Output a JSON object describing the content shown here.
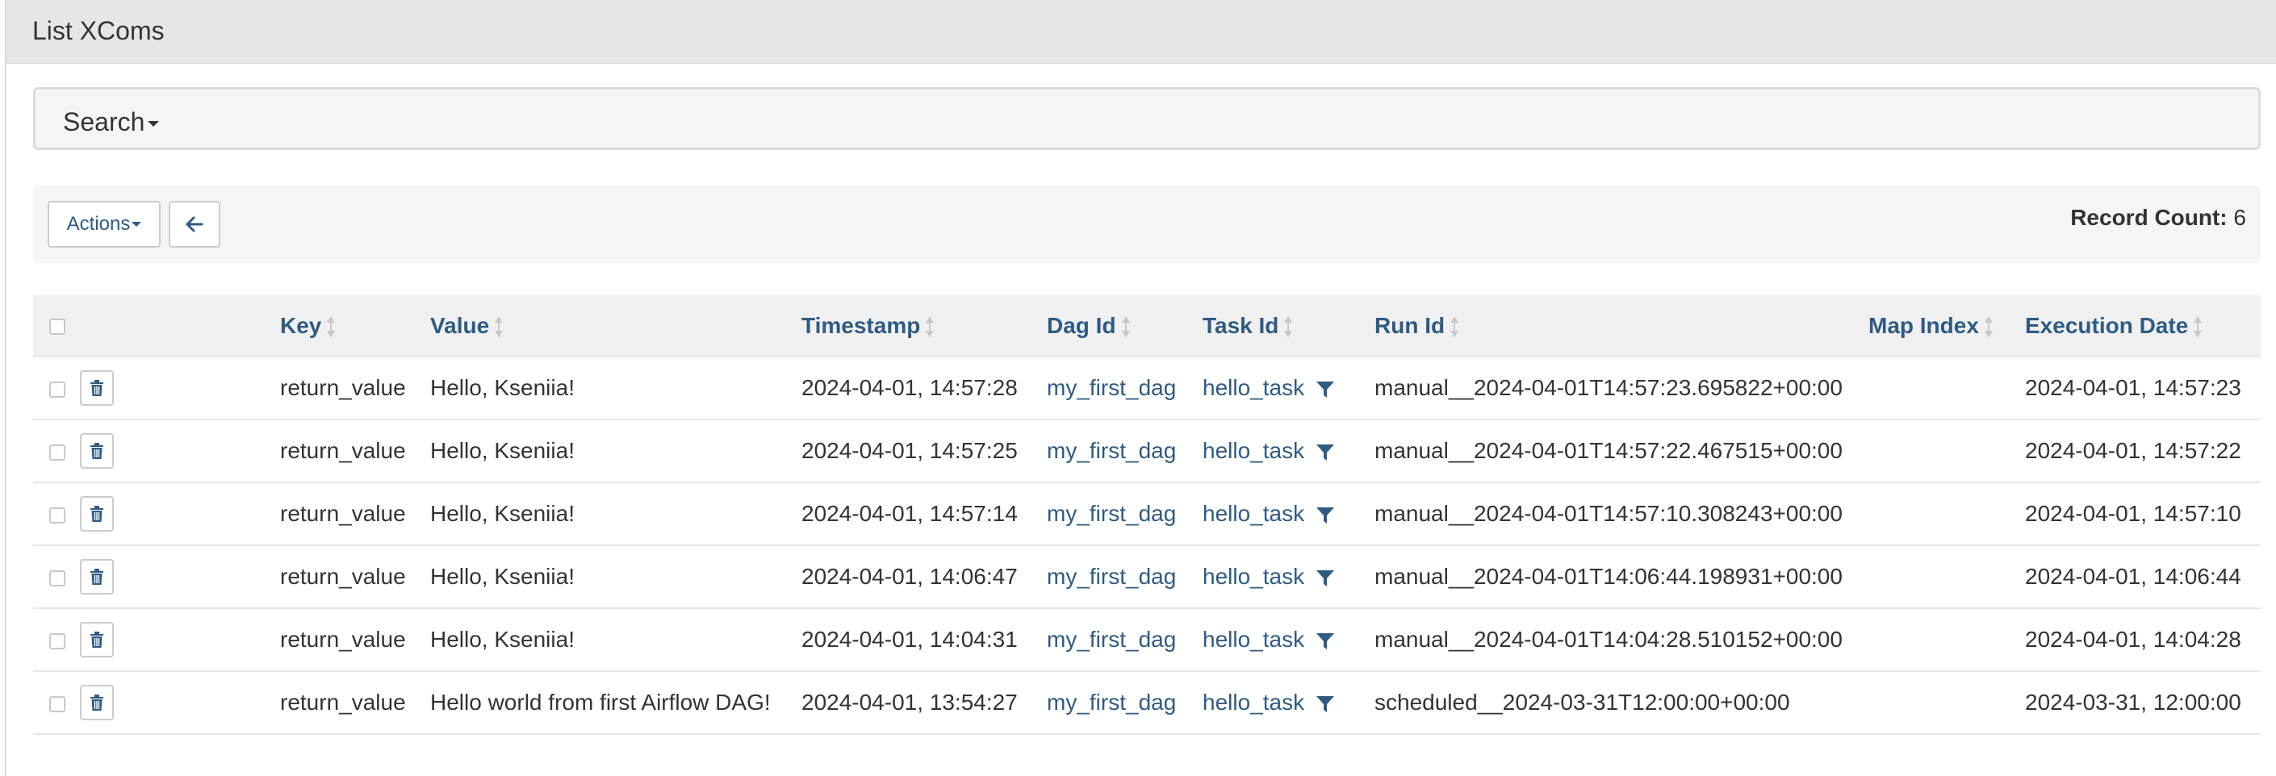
{
  "panel": {
    "title": "List XComs"
  },
  "search": {
    "label": "Search"
  },
  "toolbar": {
    "actions_label": "Actions",
    "back_icon": "arrow-left-icon",
    "record_count_label": "Record Count:",
    "record_count_value": "6"
  },
  "table": {
    "headers": {
      "key": "Key",
      "value": "Value",
      "timestamp": "Timestamp",
      "dag_id": "Dag Id",
      "task_id": "Task Id",
      "run_id": "Run Id",
      "map_index": "Map Index",
      "execution_date": "Execution Date"
    },
    "rows": [
      {
        "key": "return_value",
        "value": "Hello, Kseniia!",
        "timestamp": "2024-04-01, 14:57:28",
        "dag_id": "my_first_dag",
        "task_id": "hello_task",
        "run_id": "manual__2024-04-01T14:57:23.695822+00:00",
        "map_index": "",
        "execution_date": "2024-04-01, 14:57:23"
      },
      {
        "key": "return_value",
        "value": "Hello, Kseniia!",
        "timestamp": "2024-04-01, 14:57:25",
        "dag_id": "my_first_dag",
        "task_id": "hello_task",
        "run_id": "manual__2024-04-01T14:57:22.467515+00:00",
        "map_index": "",
        "execution_date": "2024-04-01, 14:57:22"
      },
      {
        "key": "return_value",
        "value": "Hello, Kseniia!",
        "timestamp": "2024-04-01, 14:57:14",
        "dag_id": "my_first_dag",
        "task_id": "hello_task",
        "run_id": "manual__2024-04-01T14:57:10.308243+00:00",
        "map_index": "",
        "execution_date": "2024-04-01, 14:57:10"
      },
      {
        "key": "return_value",
        "value": "Hello, Kseniia!",
        "timestamp": "2024-04-01, 14:06:47",
        "dag_id": "my_first_dag",
        "task_id": "hello_task",
        "run_id": "manual__2024-04-01T14:06:44.198931+00:00",
        "map_index": "",
        "execution_date": "2024-04-01, 14:06:44"
      },
      {
        "key": "return_value",
        "value": "Hello, Kseniia!",
        "timestamp": "2024-04-01, 14:04:31",
        "dag_id": "my_first_dag",
        "task_id": "hello_task",
        "run_id": "manual__2024-04-01T14:04:28.510152+00:00",
        "map_index": "",
        "execution_date": "2024-04-01, 14:04:28"
      },
      {
        "key": "return_value",
        "value": "Hello world from first Airflow DAG!",
        "timestamp": "2024-04-01, 13:54:27",
        "dag_id": "my_first_dag",
        "task_id": "hello_task",
        "run_id": "scheduled__2024-03-31T12:00:00+00:00",
        "map_index": "",
        "execution_date": "2024-03-31, 12:00:00"
      }
    ]
  },
  "icons": {
    "row_delete": "trash-icon",
    "task_filter": "filter-icon",
    "sort": "sort-icon"
  },
  "colors": {
    "link": "#2e5b84",
    "header_bg": "#e6e6e6",
    "toolbar_bg": "#f5f5f5"
  }
}
